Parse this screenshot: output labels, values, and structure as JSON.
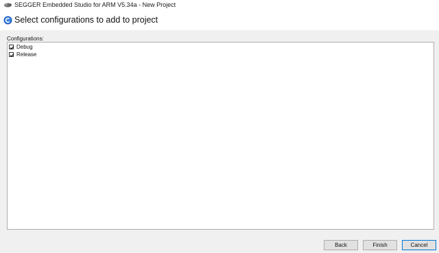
{
  "window": {
    "title": "SEGGER Embedded Studio for ARM V5.34a - New Project",
    "app_icon": "segger-chameleon-icon"
  },
  "header": {
    "icon": "wizard-icon",
    "heading": "Select configurations to add to project"
  },
  "configurations": {
    "label": "Configurations:",
    "items": [
      {
        "label": "Debug",
        "checked": true
      },
      {
        "label": "Release",
        "checked": true
      }
    ]
  },
  "buttons": {
    "back": "Back",
    "finish": "Finish",
    "cancel": "Cancel"
  },
  "colors": {
    "accent": "#0078d7",
    "wizard_icon": "#1f5fbf"
  }
}
